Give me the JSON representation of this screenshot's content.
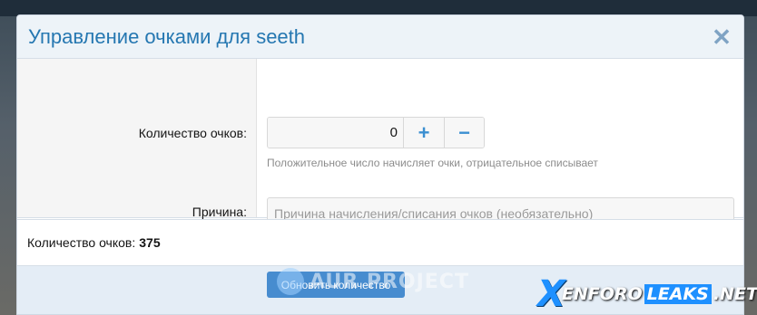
{
  "dialog": {
    "title": "Управление очками для seeth",
    "close_glyph": "✕"
  },
  "form": {
    "points_label": "Количество очков:",
    "points_value": "0",
    "plus_glyph": "+",
    "minus_glyph": "−",
    "hint": "Положительное число начисляет очки, отрицательное списывает",
    "reason_label": "Причина:",
    "reason_placeholder": "Причина начисления/списания очков (необязательно)"
  },
  "summary": {
    "label": "Количество очков:",
    "value": "375"
  },
  "footer": {
    "submit_label": "Обновить количество"
  },
  "watermarks": {
    "aur": "AUR PROJECT",
    "xf_x": "X",
    "xf_xenforo": "ENFORO",
    "xf_leaks": "LEAKS",
    "xf_net": ".NET"
  },
  "icons": {
    "close": "close-icon",
    "plus": "plus-icon",
    "minus": "minus-icon"
  },
  "colors": {
    "accent": "#2577b1",
    "button": "#478ccf",
    "step_icon": "#3b8fd1"
  }
}
